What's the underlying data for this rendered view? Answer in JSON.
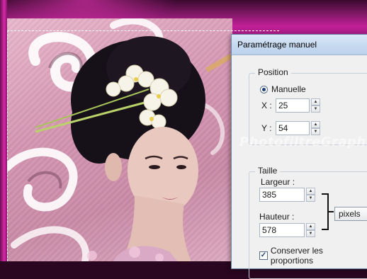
{
  "dialog": {
    "title": "Paramétrage manuel",
    "position": {
      "group_label": "Position",
      "mode_label": "Manuelle",
      "x_label": "X :",
      "x_value": "25",
      "y_label": "Y :",
      "y_value": "54"
    },
    "size": {
      "group_label": "Taille",
      "width_label": "Largeur :",
      "width_value": "385",
      "height_label": "Hauteur :",
      "height_value": "578",
      "unit_value": "pixels",
      "keep_proportions_label": "Conserver les proportions",
      "keep_proportions_checked": true
    }
  },
  "watermark": "PhotofiltreGraphic",
  "colors": {
    "frame_magenta": "#c21f97",
    "titlebar": "#c6d9ef",
    "dialog_bg": "#f0f0f0"
  }
}
